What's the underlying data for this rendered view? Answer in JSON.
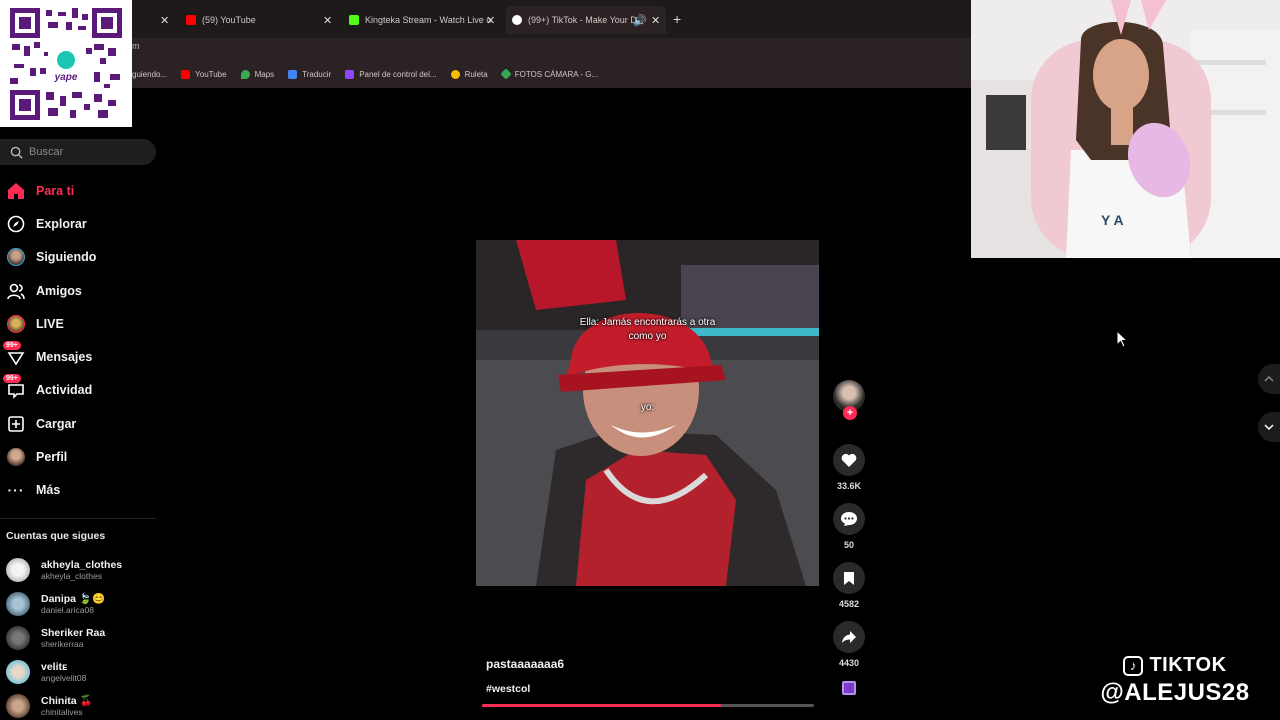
{
  "browser": {
    "tabs": [
      {
        "label": "(59) YouTube",
        "color": "#ff0000"
      },
      {
        "label": "Kingteka Stream - Watch Live o",
        "color": "#53fc18"
      },
      {
        "label": "(99+) TikTok - Make Your D",
        "color": "#ffffff"
      }
    ],
    "url_fragment": "m",
    "bookmarks": [
      {
        "label": "guiendo...",
        "color": "#888888"
      },
      {
        "label": "YouTube",
        "color": "#ff0000"
      },
      {
        "label": "Maps",
        "color": "#34a853"
      },
      {
        "label": "Traducir",
        "color": "#4285f4"
      },
      {
        "label": "Panel de control del...",
        "color": "#9146ff"
      },
      {
        "label": "Ruleta",
        "color": "#fbbc05"
      },
      {
        "label": "FOTOS CÁMARA - G...",
        "color": "#34a853"
      }
    ]
  },
  "qr": {
    "brand": "yape"
  },
  "search": {
    "placeholder": "Buscar"
  },
  "nav": [
    {
      "label": "Para ti",
      "icon": "home-icon",
      "active": true
    },
    {
      "label": "Explorar",
      "icon": "compass-icon"
    },
    {
      "label": "Siguiendo",
      "icon": "avatar"
    },
    {
      "label": "Amigos",
      "icon": "friends-icon"
    },
    {
      "label": "LIVE",
      "icon": "live-icon"
    },
    {
      "label": "Mensajes",
      "icon": "messages-icon",
      "badge": "99+"
    },
    {
      "label": "Actividad",
      "icon": "activity-icon",
      "badge": "99+"
    },
    {
      "label": "Cargar",
      "icon": "upload-icon"
    },
    {
      "label": "Perfil",
      "icon": "avatar"
    },
    {
      "label": "Más",
      "icon": "more-icon"
    }
  ],
  "following": {
    "title": "Cuentas que sigues",
    "accounts": [
      {
        "name": "akheyla_clothes",
        "user": "akheyla_clothes",
        "color": "#d9d9d9"
      },
      {
        "name": "Danipa 🍃😊",
        "user": "daniel.arica08",
        "color": "#7a9fb5"
      },
      {
        "name": "Sheriker Raa",
        "user": "sherikerraa",
        "color": "#555555"
      },
      {
        "name": "velitᴇ",
        "user": "angelvelit08",
        "color": "#6ec3d6"
      },
      {
        "name": "Chinita 🍒",
        "user": "chinitalives",
        "color": "#a3806a"
      }
    ]
  },
  "video": {
    "caption_top_1": "Ella: Jamás encontrarás a otra",
    "caption_top_2": "como yo",
    "caption_mid": "yo:",
    "author": "pastaaaaaaa6",
    "hashtag": "#westcol",
    "progress": 0.72
  },
  "actions": {
    "likes": "33.6K",
    "comments": "50",
    "saves": "4582",
    "shares": "4430"
  },
  "watermark": {
    "line1": "TIKTOK",
    "line2": "@ALEJUS28"
  },
  "colors": {
    "accent": "#fe2c55",
    "background": "#000000"
  }
}
